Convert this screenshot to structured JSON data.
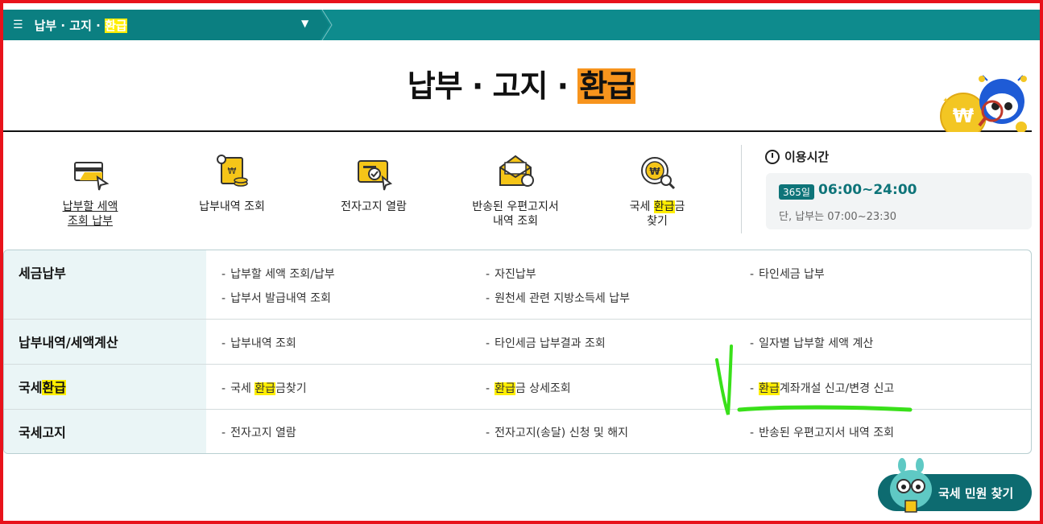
{
  "topbar": {
    "menu_icon": "hamburger-icon",
    "crumb_prefix": "납부 · 고지 · ",
    "crumb_highlight": "환급",
    "chevron_icon": "chevron-down-icon"
  },
  "title": {
    "prefix": "납부 · 고지 · ",
    "highlight": "환급"
  },
  "quick_menu": [
    {
      "label": "납부할 세액\n조회 납부",
      "icon": "tax-payment-icon",
      "underline": true
    },
    {
      "label": "납부내역 조회",
      "icon": "payment-history-icon",
      "underline": false
    },
    {
      "label": "전자고지 열람",
      "icon": "e-notice-icon",
      "underline": false
    },
    {
      "label": "반송된 우편고지서\n내역 조회",
      "icon": "returned-mail-icon",
      "underline": false
    },
    {
      "label_prefix": "국세 ",
      "label_highlight": "환급",
      "label_suffix": "금\n찾기",
      "icon": "refund-search-icon",
      "underline": false
    }
  ],
  "hours": {
    "title": "이용시간",
    "badge": "365일",
    "time": "06:00~24:00",
    "note": "단, 납부는 07:00~23:30"
  },
  "table": [
    {
      "head": "세금납부",
      "links": [
        "납부할 세액 조회/납부",
        "자진납부",
        "타인세금 납부",
        "납부서 발급내역 조회",
        "원천세 관련 지방소득세 납부"
      ]
    },
    {
      "head": "납부내역/세액계산",
      "links": [
        "납부내역 조회",
        "타인세금 납부결과 조회",
        "일자별 납부할 세액 계산"
      ]
    },
    {
      "head_prefix": "국세",
      "head_highlight": "환급",
      "links": [
        {
          "prefix": "국세 ",
          "hl": "환급",
          "suffix": "금찾기"
        },
        {
          "prefix": "",
          "hl": "환급",
          "suffix": "금 상세조회"
        },
        {
          "prefix": "",
          "hl": "환급",
          "suffix": "계좌개설 신고/변경 신고"
        }
      ]
    },
    {
      "head": "국세고지",
      "links": [
        "전자고지 열람",
        "전자고지(송달) 신청 및 해지",
        "반송된 우편고지서 내역 조회"
      ]
    }
  ],
  "fab": {
    "label": "국세 민원 찾기"
  },
  "colors": {
    "teal": "#0e8b8d",
    "dark_teal": "#0d6b70",
    "highlight": "#ffee00",
    "title_highlight": "#f7941d",
    "frame": "#e8121b",
    "annotation": "#39e01a"
  }
}
